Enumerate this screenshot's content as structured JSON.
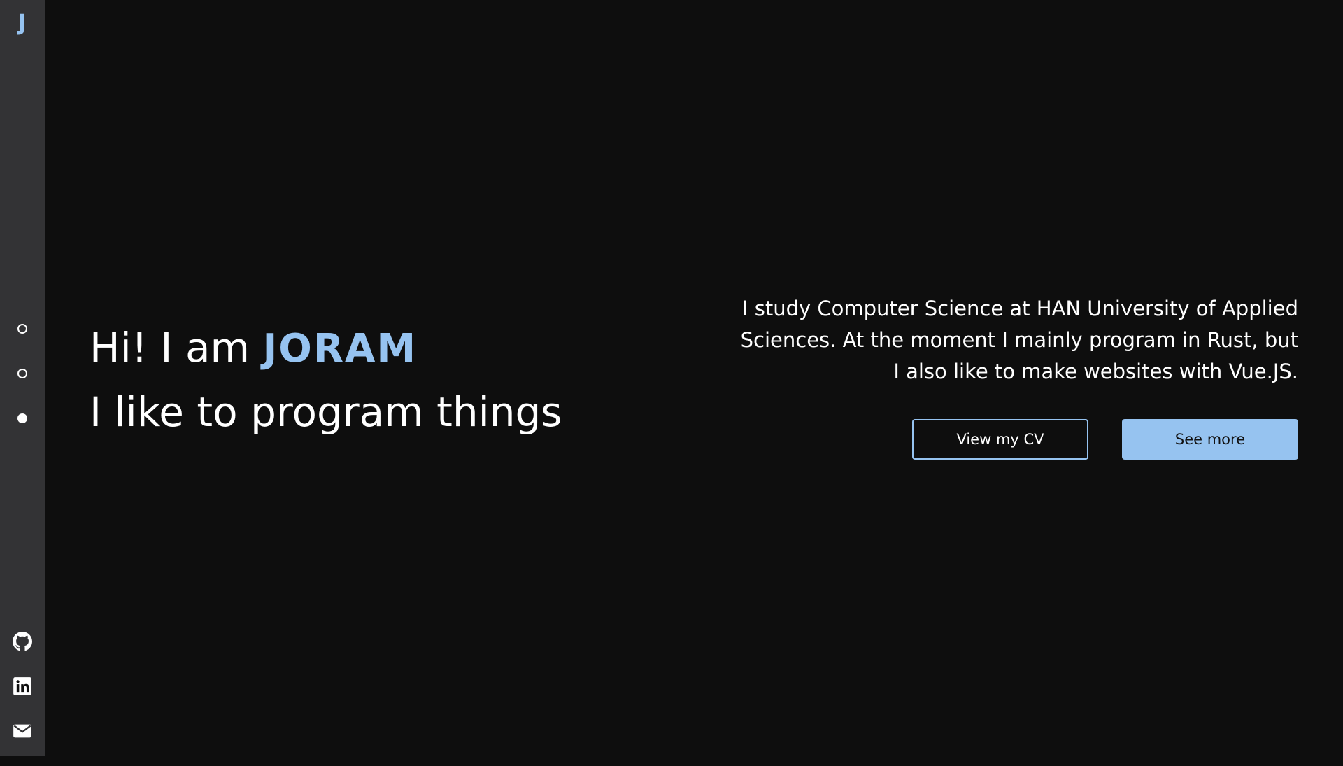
{
  "sidebar": {
    "logo": "J",
    "nav_dots": [
      {
        "name": "section-1",
        "active": false
      },
      {
        "name": "section-2",
        "active": false
      },
      {
        "name": "section-3",
        "active": true
      }
    ],
    "socials": [
      {
        "icon": "github-icon"
      },
      {
        "icon": "linkedin-icon"
      },
      {
        "icon": "mail-icon"
      }
    ]
  },
  "hero": {
    "greeting_prefix": "Hi! I am",
    "name": "JORAM",
    "tagline": "I like to program things",
    "bio": "I study Computer Science at HAN University of Applied Sciences. At the moment I mainly program in Rust, but I also like to make websites with Vue.JS.",
    "cv_button": "View my CV",
    "more_button": "See more"
  },
  "colors": {
    "background": "#0e0e0e",
    "sidebar": "#333335",
    "accent": "#96c3f0",
    "text": "#ffffff"
  }
}
